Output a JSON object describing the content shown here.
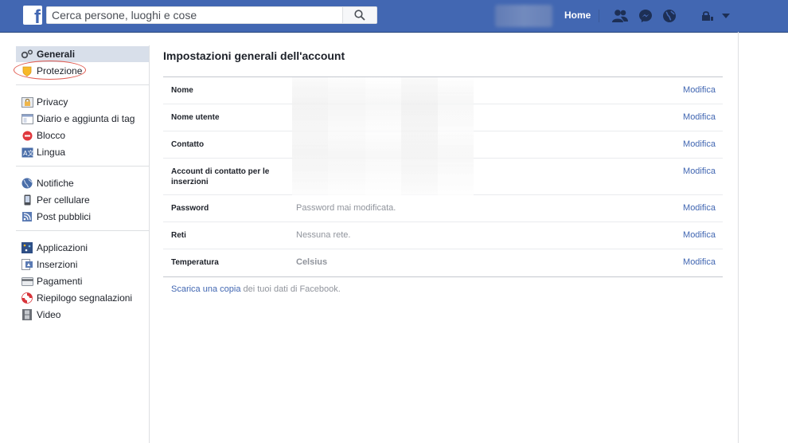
{
  "topbar": {
    "logo": "f",
    "search_placeholder": "Cerca persone, luoghi e cose",
    "home_label": "Home",
    "icons": [
      "search-icon",
      "friends-icon",
      "messenger-icon",
      "globe-icon",
      "lock-icon",
      "caret-down-icon"
    ],
    "brand_color": "#4267b2"
  },
  "sidebar": {
    "groups": [
      [
        {
          "label": "Generali",
          "icon": "gears-icon"
        },
        {
          "label": "Protezione",
          "icon": "shield-icon"
        }
      ],
      [
        {
          "label": "Privacy",
          "icon": "privacy-lock-icon"
        },
        {
          "label": "Diario e aggiunta di tag",
          "icon": "timeline-icon"
        },
        {
          "label": "Blocco",
          "icon": "block-icon"
        },
        {
          "label": "Lingua",
          "icon": "language-icon"
        }
      ],
      [
        {
          "label": "Notifiche",
          "icon": "globe-icon"
        },
        {
          "label": "Per cellulare",
          "icon": "mobile-icon"
        },
        {
          "label": "Post pubblici",
          "icon": "rss-icon"
        }
      ],
      [
        {
          "label": "Applicazioni",
          "icon": "apps-icon"
        },
        {
          "label": "Inserzioni",
          "icon": "ads-icon"
        },
        {
          "label": "Pagamenti",
          "icon": "card-icon"
        },
        {
          "label": "Riepilogo segnalazioni",
          "icon": "support-icon"
        },
        {
          "label": "Video",
          "icon": "film-icon"
        }
      ]
    ]
  },
  "main": {
    "title": "Impostazioni generali dell'account",
    "edit_label": "Modifica",
    "rows": [
      {
        "label": "Nome",
        "value": ""
      },
      {
        "label": "Nome utente",
        "value": ""
      },
      {
        "label": "Contatto",
        "value": ""
      },
      {
        "label": "Account di contatto per le inserzioni",
        "value": ""
      },
      {
        "label": "Password",
        "value": "Password mai modificata."
      },
      {
        "label": "Reti",
        "value": "Nessuna rete."
      },
      {
        "label": "Temperatura",
        "value": "Celsius"
      }
    ],
    "download_link": "Scarica una copia",
    "download_rest": " dei tuoi dati di Facebook."
  }
}
